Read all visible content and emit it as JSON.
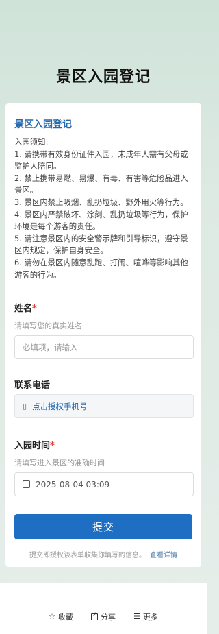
{
  "page": {
    "title": "景区入园登记"
  },
  "card": {
    "title": "景区入园登记",
    "notice_heading": "入园须知:",
    "notice_items": [
      "1. 请携带有效身份证件入园，未成年人需有父母或监护人陪同。",
      "2. 禁止携带易燃、易爆、有毒、有害等危险品进入景区。",
      "3. 景区内禁止吸烟、乱扔垃圾、野外用火等行为。",
      "4. 景区内严禁破坏、涂刻、乱扔垃圾等行为，保护环境是每个游客的责任。",
      "5. 请注意景区内的安全警示牌和引导标识，遵守景区内规定，保护自身安全。",
      "6. 请勿在景区内随意乱跑、打闹、喧哗等影响其他游客的行为。"
    ]
  },
  "form": {
    "name": {
      "label": "姓名",
      "required_mark": "*",
      "description": "请填写您的真实姓名",
      "placeholder": "必填项，请输入"
    },
    "phone": {
      "label": "联系电话",
      "button_text": "点击授权手机号",
      "icon": "phone-icon"
    },
    "entry_time": {
      "label": "入园时间",
      "required_mark": "*",
      "description": "请填写进入景区的准确时间",
      "value": "2025-08-04 03:09",
      "icon": "calendar-icon"
    },
    "submit_label": "提交",
    "footer_note": "提交即授权该表单收集你填写的信息。",
    "footer_link": "查看详情"
  },
  "bottom_bar": {
    "favorite": "收藏",
    "share": "分享",
    "more": "更多"
  },
  "colors": {
    "accent": "#1e6fc4",
    "required": "#e03a3a"
  }
}
